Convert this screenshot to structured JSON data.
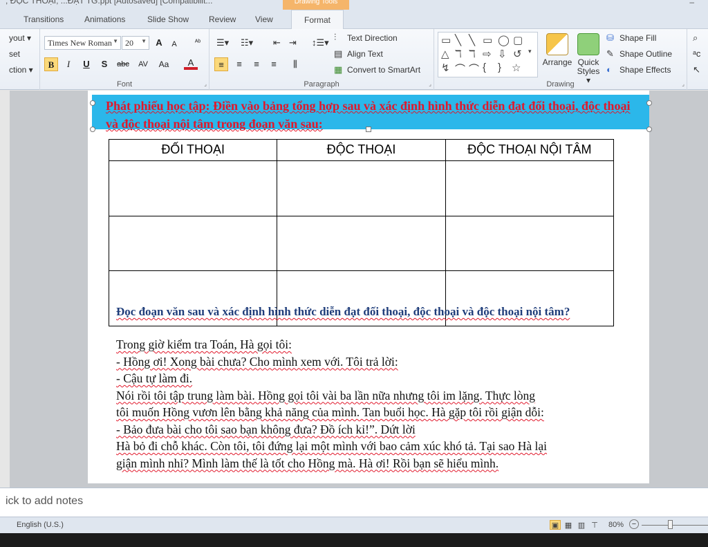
{
  "titlebar": {
    "title": ", ĐỘC THOẠI, ...ĐẠT TG.ppt [Autosaved] [Compatibilit...",
    "context_tab": "Drawing Tools",
    "control_glyph": "–"
  },
  "tabs": [
    "Transitions",
    "Animations",
    "Slide Show",
    "Review",
    "View",
    "Format"
  ],
  "ribbon": {
    "slides_group": [
      "yout ▾",
      "set",
      "ction ▾"
    ],
    "font": {
      "label": "Font",
      "name": "Times New Roman",
      "size": "20",
      "buttons": {
        "grow": "A",
        "shrink": "A",
        "clear": "ᴬᵇ",
        "bold": "B",
        "italic": "I",
        "underline": "U",
        "shadow": "S",
        "strike": "abc",
        "spacing": "AV",
        "case": "Aa",
        "color": "A"
      }
    },
    "paragraph": {
      "label": "Paragraph",
      "text_direction": "Text Direction",
      "align_text": "Align Text",
      "convert_smartart": "Convert to SmartArt"
    },
    "drawing": {
      "label": "Drawing",
      "arrange": "Arrange",
      "quick_styles": [
        "Quick",
        "Styles"
      ],
      "shape_fill": "Shape Fill",
      "shape_outline": "Shape Outline",
      "shape_effects": "Shape Effects"
    }
  },
  "slide": {
    "header": "Phát phiếu học tập: Điền vào bảng tổng hợp sau và xác định hình thức diễn đạt đối thoại, độc thoại và độc thoại nội tâm trong đoạn văn sau:",
    "table_headers": [
      "ĐỐI THOẠI",
      "ĐỘC THOẠI",
      "ĐỘC THOẠI NỘI TÂM"
    ],
    "passage_title": "Đọc đoạn văn sau và xác định hình thức diễn đạt đối thoại, độc thoại và độc thoại nội tâm?",
    "passage_lines": [
      "    Trong giờ kiểm tra Toán, Hà gọi tôi:",
      "-  Hồng ơi! Xong bài chưa? Cho mình xem với. Tôi trả lời:",
      "-  Cậu tự làm đi.",
      "  Nói rồi tôi tập trung làm bài. Hồng gọi tôi vài ba lần nữa nhưng tôi im lặng. Thực lòng",
      "tôi muốn Hồng vươn lên bằng khả năng của mình. Tan buổi học. Hà gặp tôi rồi giận dỗi:",
      " - Bảo đưa bài cho tôi sao bạn không đưa? Đồ ích kỉ!”. Dứt lời",
      "Hà bỏ đi chỗ khác. Còn tôi, tôi đứng lại một mình với bao cảm xúc khó tả. Tại sao Hà lại",
      "giận mình nhỉ? Mình làm thế là tốt cho Hồng mà. Hà ơi! Rồi bạn sẽ hiểu mình."
    ]
  },
  "notes": {
    "placeholder": "ick to add notes"
  },
  "statusbar": {
    "language": "English (U.S.)",
    "zoom": "80%"
  }
}
